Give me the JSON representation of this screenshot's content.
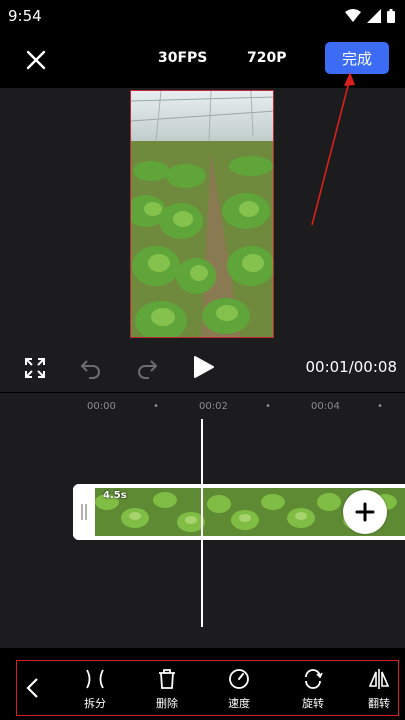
{
  "status_bar": {
    "time": "9:54"
  },
  "top_bar": {
    "fps": "30FPS",
    "resolution": "720P",
    "done_label": "完成"
  },
  "player": {
    "current_time": "00:01",
    "total_time": "00:08",
    "time_display": "00:01/00:08"
  },
  "timeline": {
    "ticks": [
      "00:00",
      "00:02",
      "00:04"
    ],
    "clip_duration": "4.5s"
  },
  "toolbar": {
    "items": [
      {
        "label": "拆分",
        "icon": "split-icon"
      },
      {
        "label": "删除",
        "icon": "trash-icon"
      },
      {
        "label": "速度",
        "icon": "speed-icon"
      },
      {
        "label": "旋转",
        "icon": "rotate-icon"
      },
      {
        "label": "翻转",
        "icon": "flip-icon"
      }
    ]
  },
  "colors": {
    "accent": "#3c6cf5",
    "highlight": "#d8201f",
    "panel": "#1c1c1e"
  }
}
